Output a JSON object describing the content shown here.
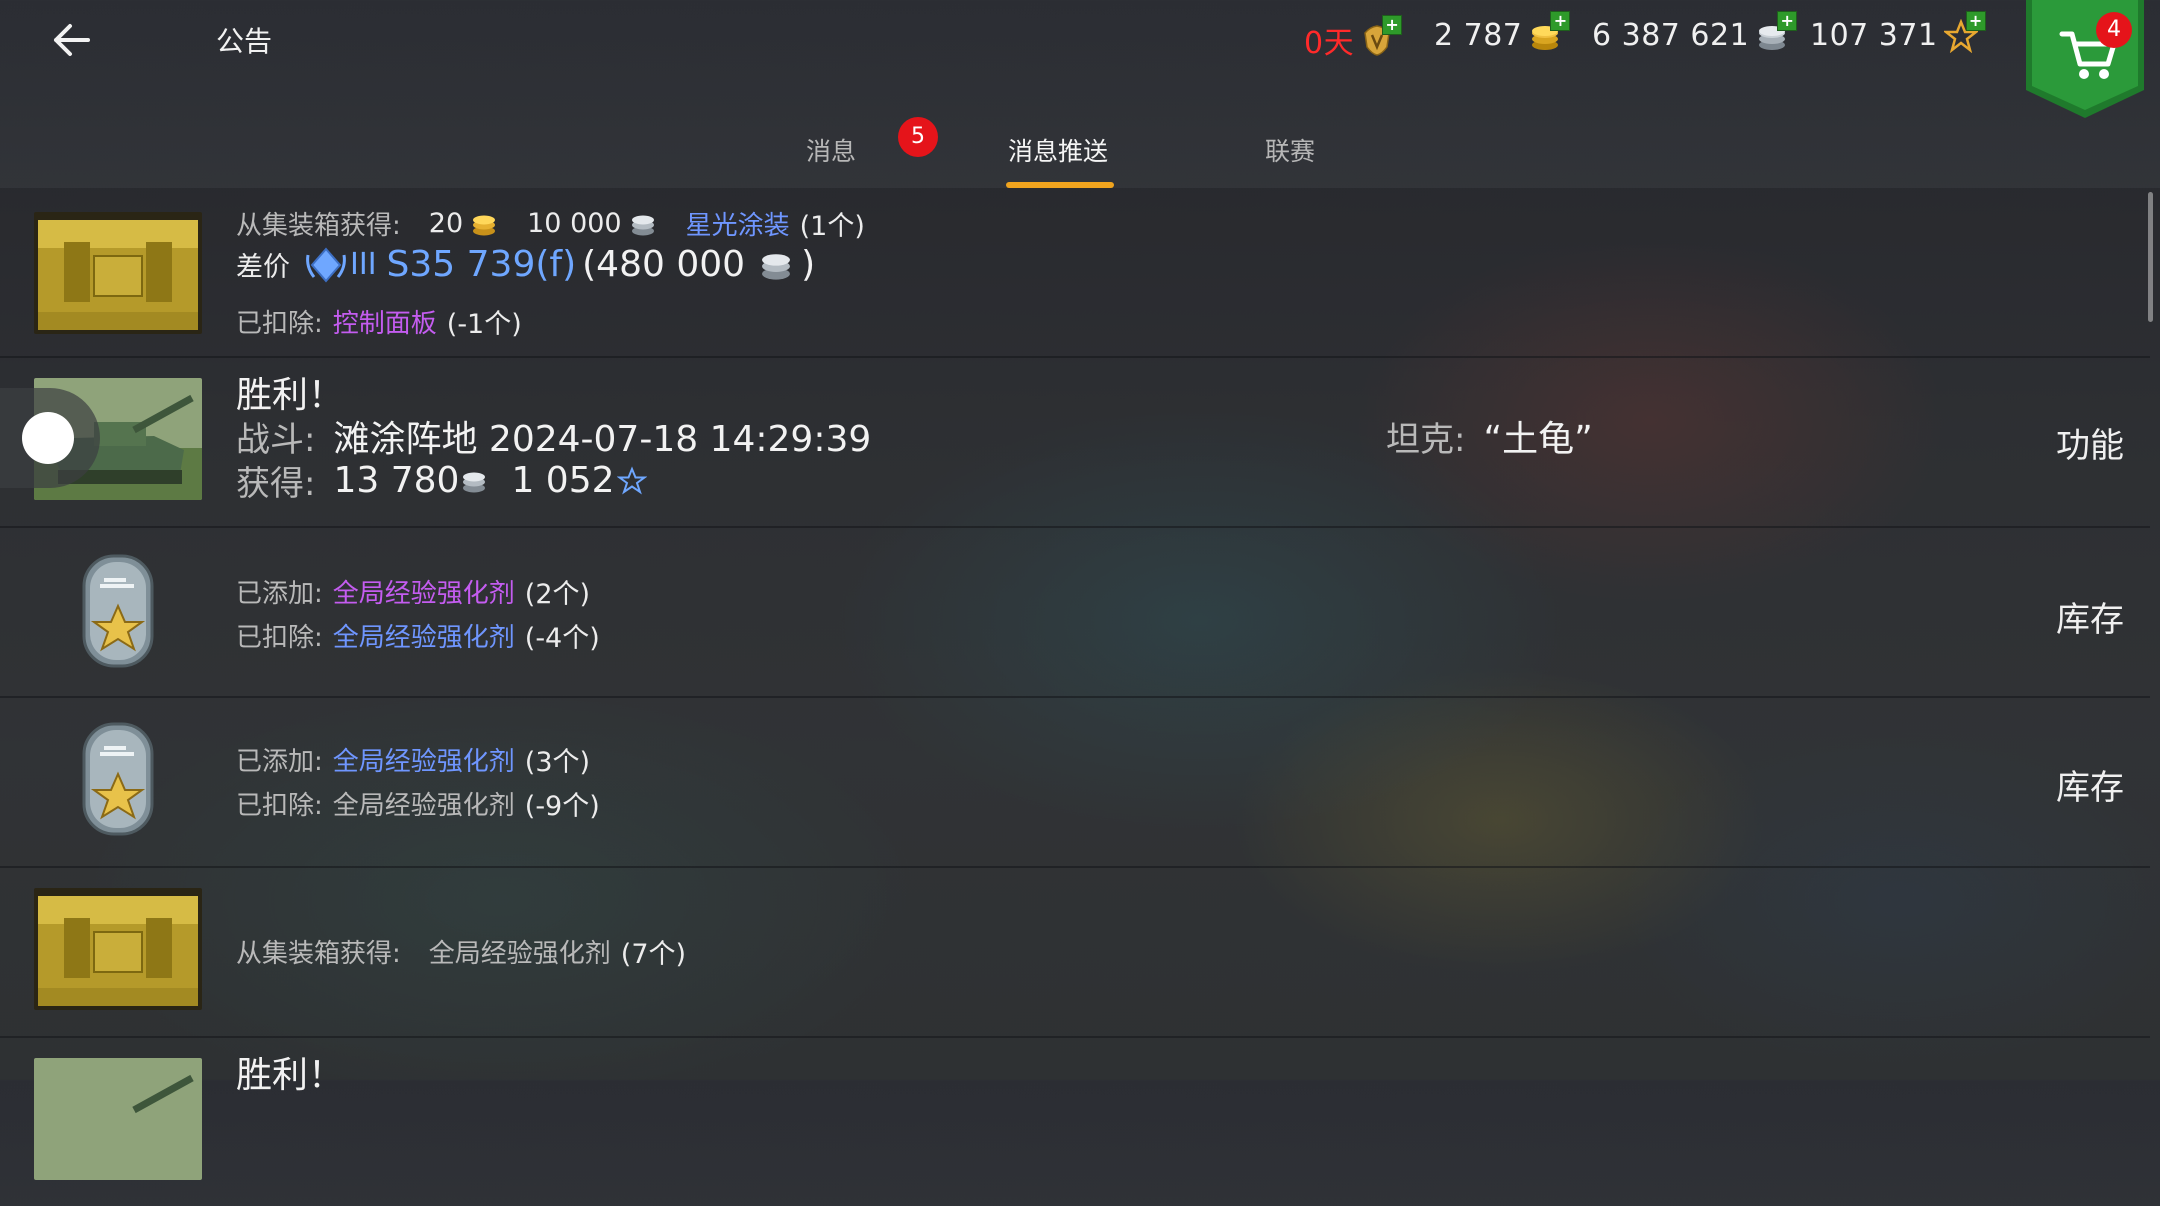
{
  "header": {
    "title": "公告",
    "premium_days": "0天",
    "gold": "2 787",
    "credits": "6 387 621",
    "free_xp": "107 371",
    "cart_count": "4"
  },
  "tabs": [
    {
      "label": "消息",
      "badge": "5"
    },
    {
      "label": "消息推送",
      "active": true
    },
    {
      "label": "联赛"
    }
  ],
  "messages": [
    {
      "type": "container",
      "source_label": "从集装箱获得:",
      "gold": "20",
      "credits": "10 000",
      "item": "星光涂装",
      "item_qty": "(1个)",
      "diff_label": "差价",
      "tier": "III",
      "tank": "S35 739(f)",
      "diff_value_open": "(480 000",
      "diff_value_close": ")",
      "removed_label": "已扣除:",
      "removed_item": "控制面板",
      "removed_qty": "(-1个)"
    },
    {
      "type": "battle",
      "title": "胜利！",
      "battle_label": "战斗:",
      "battle_value": "滩涂阵地 2024-07-18 14:29:39",
      "tank_label": "坦克:",
      "tank_value": "“土龟”",
      "earned_label": "获得:",
      "earned_credits": "13 780",
      "earned_xp": "1 052",
      "action": "功能"
    },
    {
      "type": "booster",
      "added_label": "已添加:",
      "added_item": "全局经验强化剂",
      "added_qty": "(2个)",
      "removed_label": "已扣除:",
      "removed_item": "全局经验强化剂",
      "removed_qty": "(-4个)",
      "action": "库存"
    },
    {
      "type": "booster",
      "added_label": "已添加:",
      "added_item": "全局经验强化剂",
      "added_qty": "(3个)",
      "removed_label": "已扣除:",
      "removed_item": "全局经验强化剂",
      "removed_qty": "(-9个)",
      "action": "库存"
    },
    {
      "type": "container",
      "source_label": "从集装箱获得:",
      "item": "全局经验强化剂",
      "item_qty": "(7个)"
    },
    {
      "type": "battle",
      "title": "胜利！"
    }
  ],
  "colors": {
    "accent_tab": "#f0a41e",
    "badge_red": "#e5141a",
    "purple_item": "#c45cf0",
    "blue_item": "#6f96ff",
    "premium_red": "#ff2a2a"
  }
}
